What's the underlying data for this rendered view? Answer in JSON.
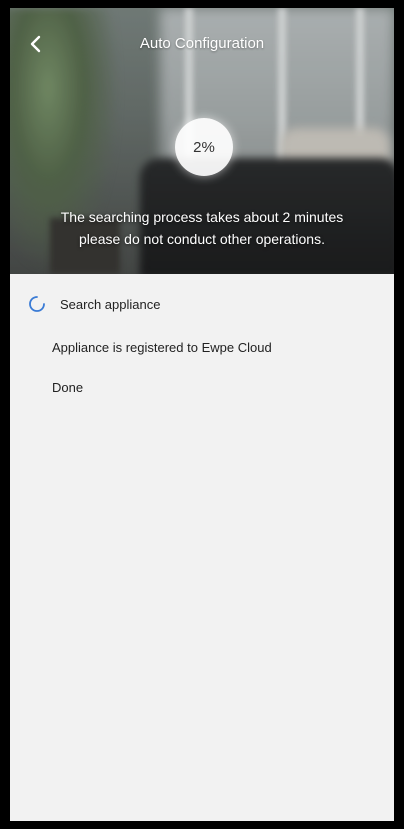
{
  "header": {
    "title": "Auto Configuration",
    "back_icon": "chevron-left-icon"
  },
  "progress": {
    "label": "2%",
    "value_percent": 2
  },
  "hero": {
    "message_line1": "The searching process takes about 2 minutes",
    "message_line2": "please do not conduct other operations."
  },
  "steps": [
    {
      "label": "Search appliance",
      "status": "in-progress",
      "icon": "spinner-icon"
    },
    {
      "label": "Appliance is registered to Ewpe Cloud",
      "status": "pending"
    },
    {
      "label": "Done",
      "status": "pending"
    }
  ],
  "colors": {
    "accent": "#3a7bd5",
    "background": "#f2f2f2",
    "text": "#222222"
  }
}
